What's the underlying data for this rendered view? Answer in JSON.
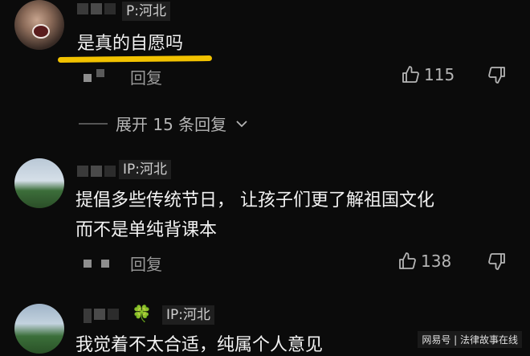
{
  "comments": [
    {
      "ip": "P:河北",
      "text": "是真的自愿吗",
      "reply": "回复",
      "likes": "115"
    },
    {
      "ip": "IP:河北",
      "line1": "提倡多些传统节日， 让孩子们更了解祖国文化",
      "line2": "而不是单纯背课本",
      "reply": "回复",
      "likes": "138"
    },
    {
      "ip": "IP:河北",
      "text": "我觉着不太合适，纯属个人意见",
      "badge": "🍀"
    }
  ],
  "expand_replies": "展开 15 条回复",
  "watermark": "网易号 | 法律故事在线",
  "colors": {
    "accent_underline": "#f2c200",
    "background": "#0b0b0b"
  }
}
